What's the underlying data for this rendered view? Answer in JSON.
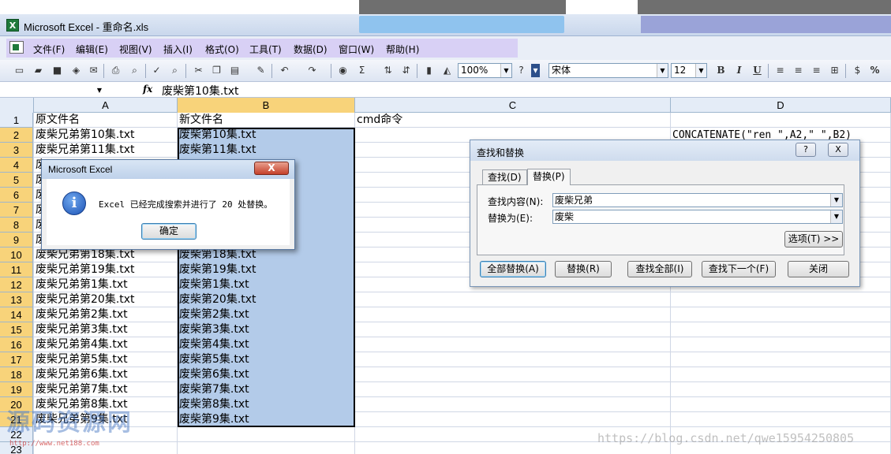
{
  "window": {
    "title": "Microsoft Excel - 重命名.xls",
    "app_icon": "excel-icon"
  },
  "menu": [
    "文件(F)",
    "编辑(E)",
    "视图(V)",
    "插入(I)",
    "格式(O)",
    "工具(T)",
    "数据(D)",
    "窗口(W)",
    "帮助(H)"
  ],
  "toolbar": {
    "zoom": "100%",
    "font": "宋体",
    "font_size": "12",
    "bold": "B",
    "italic": "I",
    "underline": "U",
    "sigma": "Σ",
    "percent": "%"
  },
  "formula_bar": {
    "name_box": "",
    "fx": "fx",
    "content": "废柴第10集.txt"
  },
  "columns": [
    "A",
    "B",
    "C",
    "D"
  ],
  "rows": [
    "1",
    "2",
    "3",
    "4",
    "5",
    "6",
    "7",
    "8",
    "9",
    "10",
    "11",
    "12",
    "13",
    "14",
    "15",
    "16",
    "17",
    "18",
    "19",
    "20",
    "21",
    "22",
    "23"
  ],
  "sheet": {
    "a_header": "原文件名",
    "b_header": "新文件名",
    "c_header": "cmd命令",
    "d2": "CONCATENATE(\"ren \",A2,\" \",B2)",
    "col_a": [
      "废柴兄弟第10集.txt",
      "废柴兄弟第11集.txt",
      "废",
      "废",
      "废",
      "废",
      "废",
      "废",
      "废柴兄弟第18集.txt",
      "废柴兄弟第19集.txt",
      "废柴兄弟第1集.txt",
      "废柴兄弟第20集.txt",
      "废柴兄弟第2集.txt",
      "废柴兄弟第3集.txt",
      "废柴兄弟第4集.txt",
      "废柴兄弟第5集.txt",
      "废柴兄弟第6集.txt",
      "废柴兄弟第7集.txt",
      "废柴兄弟第8集.txt",
      "废柴兄弟第9集.txt"
    ],
    "col_b": [
      "废柴第10集.txt",
      "废柴第11集.txt",
      "",
      "",
      "",
      "",
      "",
      "",
      "废柴第18集.txt",
      "废柴第19集.txt",
      "废柴第1集.txt",
      "废柴第20集.txt",
      "废柴第2集.txt",
      "废柴第3集.txt",
      "废柴第4集.txt",
      "废柴第5集.txt",
      "废柴第6集.txt",
      "废柴第7集.txt",
      "废柴第8集.txt",
      "废柴第9集.txt"
    ]
  },
  "find_replace": {
    "title": "查找和替换",
    "help": "?",
    "close": "X",
    "tab_find": "查找(D)",
    "tab_replace": "替换(P)",
    "find_label": "查找内容(N):",
    "find_value": "废柴兄弟",
    "replace_label": "替换为(E):",
    "replace_value": "废柴",
    "options": "选项(T) >>",
    "btn_replace_all": "全部替换(A)",
    "btn_replace": "替换(R)",
    "btn_find_all": "查找全部(I)",
    "btn_find_next": "查找下一个(F)",
    "btn_close": "关闭"
  },
  "message_box": {
    "title": "Microsoft Excel",
    "message": "Excel 已经完成搜索并进行了 20 处替换。",
    "ok": "确定",
    "close": "X",
    "icon": "info-icon"
  },
  "watermarks": {
    "site_cn": "源码资源网",
    "site_url": "http://www.net188.com",
    "blog_url": "https://blog.csdn.net/qwe15954250805"
  }
}
